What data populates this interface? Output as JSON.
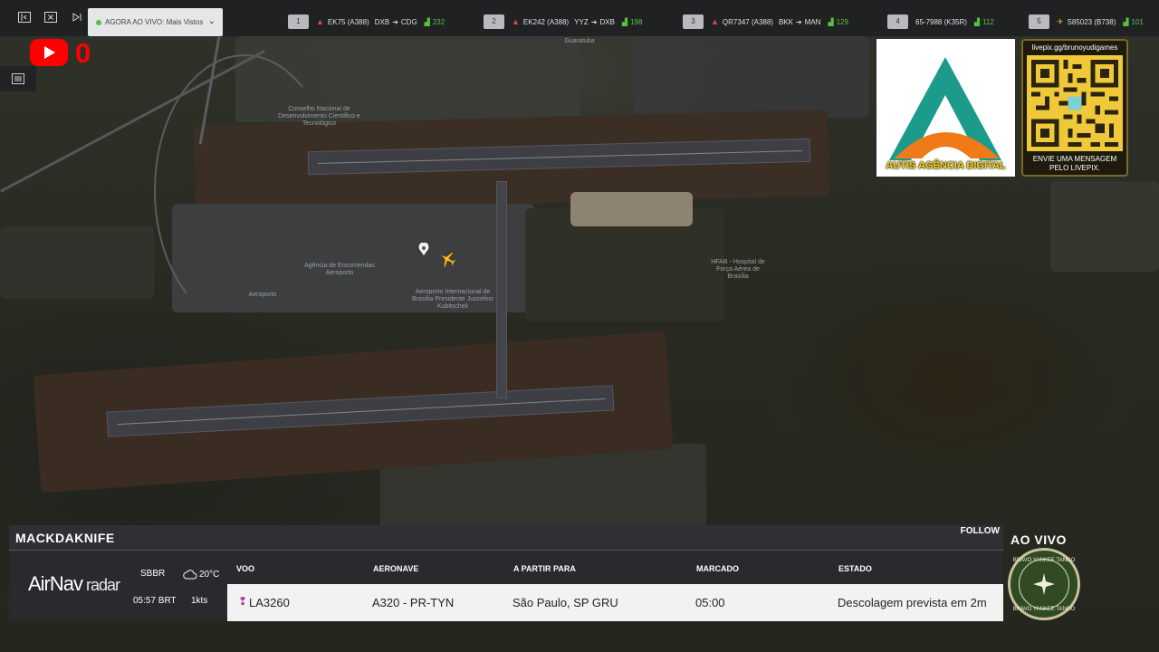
{
  "topbar": {
    "live_label": "AGORA AO VIVO: Mais Vistos",
    "flights": [
      {
        "rank": "1",
        "callsign": "EK75 (A388)",
        "from": "DXB",
        "to": "CDG",
        "count": "232"
      },
      {
        "rank": "2",
        "callsign": "EK242 (A388)",
        "from": "YYZ",
        "to": "DXB",
        "count": "198"
      },
      {
        "rank": "3",
        "callsign": "QR7347 (A388)",
        "from": "BKK",
        "to": "MAN",
        "count": "129"
      },
      {
        "rank": "4",
        "callsign": "65-7988 (K35R)",
        "from": "",
        "to": "",
        "count": "112"
      },
      {
        "rank": "5",
        "callsign": "S85023 (B738)",
        "from": "",
        "to": "",
        "count": "101"
      }
    ]
  },
  "youtube": {
    "count": "0"
  },
  "branding": {
    "agency_name": "AUTIS AGÊNCIA DIGITAL",
    "qr_url": "livepix.gg/brunoyudigames",
    "qr_message": "ENVIE UMA MENSAGEM PELO LIVEPIX."
  },
  "map_labels": {
    "cnpq": "Conselho Nacional de Desenvolvimento Científico e Tecnológico",
    "encomendas": "Agência de Encomendas Aeroporto",
    "airport": "Aeroporto Internacional de Brasília Presidente Juscelino Kubitschek",
    "hospital": "HFAB - Hospital de Força Aérea de Brasília",
    "guaratuba": "Guaratuba",
    "aeroporto": "Aeroporto"
  },
  "panel": {
    "title": "MACKDAKNIFE",
    "follow": "FOLLOW",
    "brand_main": "AirNav",
    "brand_sub": "radar",
    "airport_code": "SBBR",
    "temperature": "20°C",
    "local_time": "05:57 BRT",
    "wind": "1kts",
    "headers": {
      "flight": "VOO",
      "aircraft": "AERONAVE",
      "route": "A PARTIR PARA",
      "scheduled": "MARCADO",
      "status": "ESTADO"
    },
    "row": {
      "flight": "LA3260",
      "aircraft": "A320 - PR-TYN",
      "route": "São Paulo, SP GRU",
      "scheduled": "05:00",
      "status": "Descolagem prevista em 2m"
    }
  },
  "live": {
    "label": "AO VIVO",
    "badge_top": "BRAVO YANKEE TANGO",
    "badge_bottom": "BRAVO YANKEE TANGO"
  },
  "colors": {
    "accent_green": "#58c23d",
    "youtube_red": "#ff0000",
    "brand_yellow": "#ffd500"
  }
}
